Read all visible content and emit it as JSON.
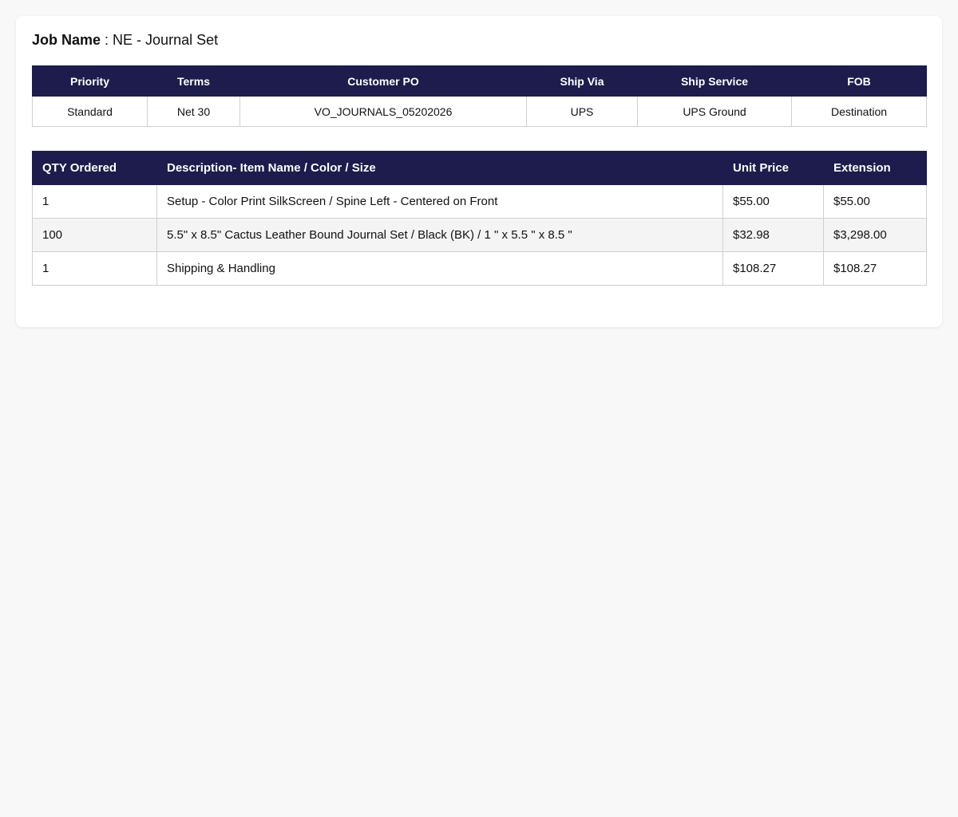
{
  "job": {
    "label": "Job Name",
    "separator": " : ",
    "value": "NE - Journal Set"
  },
  "order_info": {
    "headers": [
      "Priority",
      "Terms",
      "Customer PO",
      "Ship Via",
      "Ship Service",
      "FOB"
    ],
    "values": [
      "Standard",
      "Net 30",
      "VO_JOURNALS_05202026",
      "UPS",
      "UPS Ground",
      "Destination"
    ]
  },
  "items": {
    "headers": [
      "QTY Ordered",
      "Description- Item Name / Color / Size",
      "Unit Price",
      "Extension"
    ],
    "rows": [
      [
        "1",
        "Setup - Color Print SilkScreen / Spine Left - Centered on Front",
        "$55.00",
        "$55.00"
      ],
      [
        "100",
        "5.5\" x 8.5\" Cactus Leather Bound Journal Set / Black (BK) / 1 \" x 5.5 \" x 8.5 \"",
        "$32.98",
        "$3,298.00"
      ],
      [
        "1",
        "Shipping & Handling",
        "$108.27",
        "$108.27"
      ]
    ]
  },
  "colors": {
    "header_bg": "#1d1c4d",
    "page_bg": "#f8f8f8"
  }
}
